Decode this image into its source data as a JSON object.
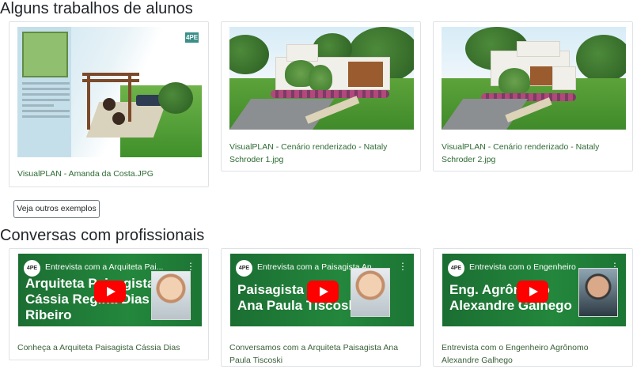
{
  "sections": {
    "works_title": "Alguns trabalhos de alunos",
    "talks_title": "Conversas com profissionais"
  },
  "works": [
    {
      "caption": "VisualPLAN - Amanda da Costa.JPG"
    },
    {
      "caption": "VisualPLAN - Cenário renderizado - Nataly Schroder 1.jpg"
    },
    {
      "caption": "VisualPLAN - Cenário renderizado - Nataly Schroder 2.jpg"
    }
  ],
  "more_button": "Veja outros exemplos",
  "badge": "4PE",
  "videos": [
    {
      "overlay_title": "Entrevista com a Arquiteta Pai...",
      "big_text": [
        "Arquiteta Paisagista",
        "Cássia Regina Dias",
        "Ribeiro"
      ],
      "caption": "Conheça a Arquiteta Paisagista Cássia Dias"
    },
    {
      "overlay_title": "Entrevista com a Paisagista An...",
      "big_text": [
        "Paisagista",
        "Ana Paula Tiscoski"
      ],
      "caption": "Conversamos com a Arquiteta Paisagista Ana Paula Tiscoski"
    },
    {
      "overlay_title": "Entrevista com o Engenheiro ...",
      "big_text": [
        "Eng. Agrônomo",
        "Alexandre Galhego"
      ],
      "caption": "Entrevista com o Engenheiro Agrônomo Alexandre Galhego"
    }
  ],
  "icons": {
    "play": "youtube-play-icon",
    "menu": "more-vert-icon"
  },
  "colors": {
    "caption_link": "#2e6b34",
    "yt_red": "#ff0000",
    "video_green": "#23873c"
  }
}
